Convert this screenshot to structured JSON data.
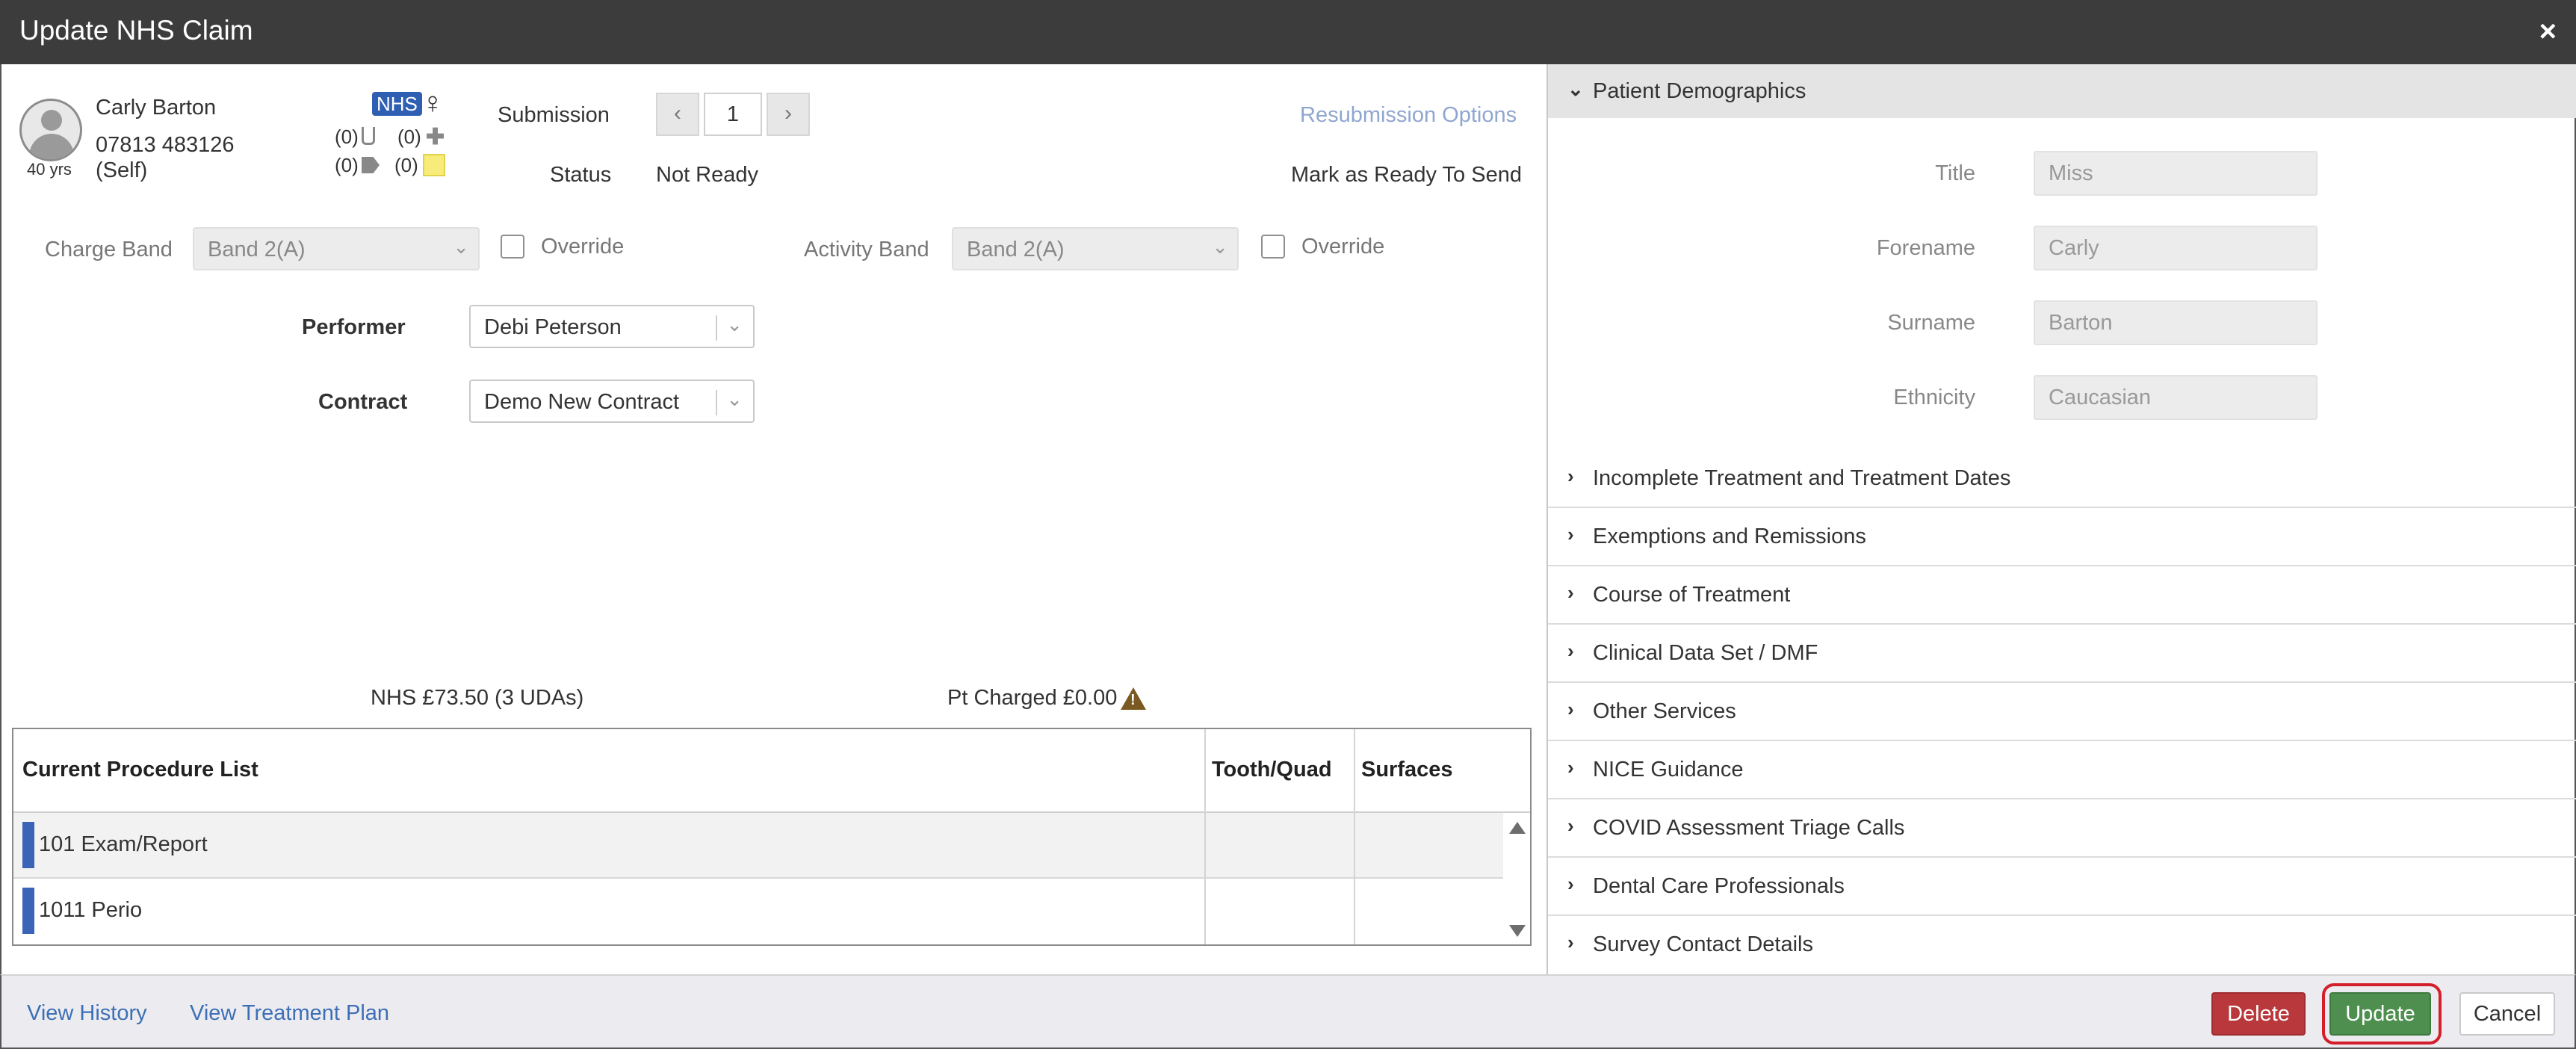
{
  "window": {
    "title": "Update NHS Claim",
    "close": "×"
  },
  "patient": {
    "name": "Carly Barton",
    "phone": "07813 483126",
    "relation": "(Self)",
    "age": "40 yrs",
    "badge": "NHS",
    "gender_symbol": "♀",
    "counts": {
      "lab": "(0)",
      "medical": "(0)",
      "tags": "(0)",
      "notes": "(0)"
    }
  },
  "submission": {
    "label": "Submission",
    "value": "1",
    "status_label": "Status",
    "status_value": "Not Ready"
  },
  "links": {
    "resubmission": "Resubmission Options",
    "mark_ready": "Mark as Ready To Send"
  },
  "bands": {
    "charge_label": "Charge Band",
    "charge_value": "Band 2(A)",
    "activity_label": "Activity Band",
    "activity_value": "Band 2(A)",
    "override": "Override"
  },
  "performer": {
    "label": "Performer",
    "value": "Debi Peterson"
  },
  "contract": {
    "label": "Contract",
    "value": "Demo New Contract"
  },
  "totals": {
    "nhs": "NHS £73.50 (3 UDAs)",
    "pt": "Pt Charged £0.00"
  },
  "table": {
    "headers": [
      "Current Procedure List",
      "Tooth/Quad",
      "Surfaces"
    ],
    "rows": [
      {
        "name": "101 Exam/Report",
        "tooth": "",
        "surfaces": ""
      },
      {
        "name": "1011 Perio",
        "tooth": "",
        "surfaces": ""
      }
    ]
  },
  "demographics": {
    "title": "Patient Demographics",
    "fields": [
      {
        "label": "Title",
        "value": "Miss"
      },
      {
        "label": "Forename",
        "value": "Carly"
      },
      {
        "label": "Surname",
        "value": "Barton"
      },
      {
        "label": "Ethnicity",
        "value": "Caucasian"
      }
    ]
  },
  "sections": [
    "Incomplete Treatment and Treatment Dates",
    "Exemptions and Remissions",
    "Course of Treatment",
    "Clinical Data Set / DMF",
    "Other Services",
    "NICE Guidance",
    "COVID Assessment Triage Calls",
    "Dental Care Professionals",
    "Survey Contact Details"
  ],
  "footer": {
    "view_history": "View History",
    "view_plan": "View Treatment Plan",
    "delete": "Delete",
    "update": "Update",
    "cancel": "Cancel"
  },
  "colors": {
    "titlebar": "#3c3c3c",
    "link": "#3d6fb6",
    "delete": "#b9383b",
    "update": "#4e8f4f",
    "highlight": "#d41f2b"
  }
}
